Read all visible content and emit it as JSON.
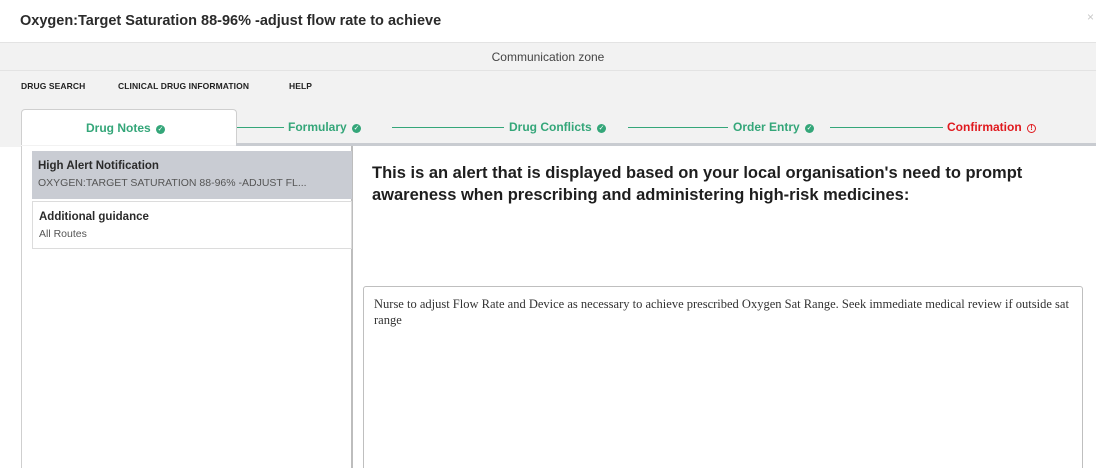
{
  "window": {
    "title": "Oxygen:Target Saturation 88-96% -adjust flow rate to achieve",
    "close_symbol": "×"
  },
  "communication_zone": {
    "label": "Communication zone"
  },
  "menu": {
    "items": [
      {
        "label": "DRUG SEARCH"
      },
      {
        "label": "CLINICAL DRUG INFORMATION"
      },
      {
        "label": "HELP"
      }
    ]
  },
  "stepper": {
    "steps": [
      {
        "label": "Drug Notes",
        "status": "complete",
        "icon": "check-circle-icon",
        "active": true
      },
      {
        "label": "Formulary",
        "status": "complete",
        "icon": "check-circle-icon"
      },
      {
        "label": "Drug Conflicts",
        "status": "complete",
        "icon": "check-circle-icon"
      },
      {
        "label": "Order Entry",
        "status": "complete",
        "icon": "check-circle-icon"
      },
      {
        "label": "Confirmation",
        "status": "warning",
        "icon": "alert-circle-icon"
      }
    ],
    "check_glyph": "✓",
    "alert_glyph": "!"
  },
  "sidebar": {
    "items": [
      {
        "title": "High Alert Notification",
        "subtitle": "OXYGEN:TARGET SATURATION 88-96% -ADJUST FL...",
        "selected": true
      },
      {
        "title": "Additional guidance",
        "subtitle": "All Routes",
        "selected": false
      }
    ]
  },
  "main": {
    "heading": "This is an alert that is displayed based on your local organisation's need to prompt awareness when prescribing and administering high-risk medicines:",
    "notes_text": "Nurse to adjust Flow Rate and Device as necessary to achieve prescribed Oxygen Sat Range. Seek immediate medical review if outside sat range"
  },
  "colors": {
    "complete": "#34a679",
    "warning": "#e0191e",
    "selected_bg": "#c9ccd3",
    "zone_bg": "#f2f2f2"
  }
}
